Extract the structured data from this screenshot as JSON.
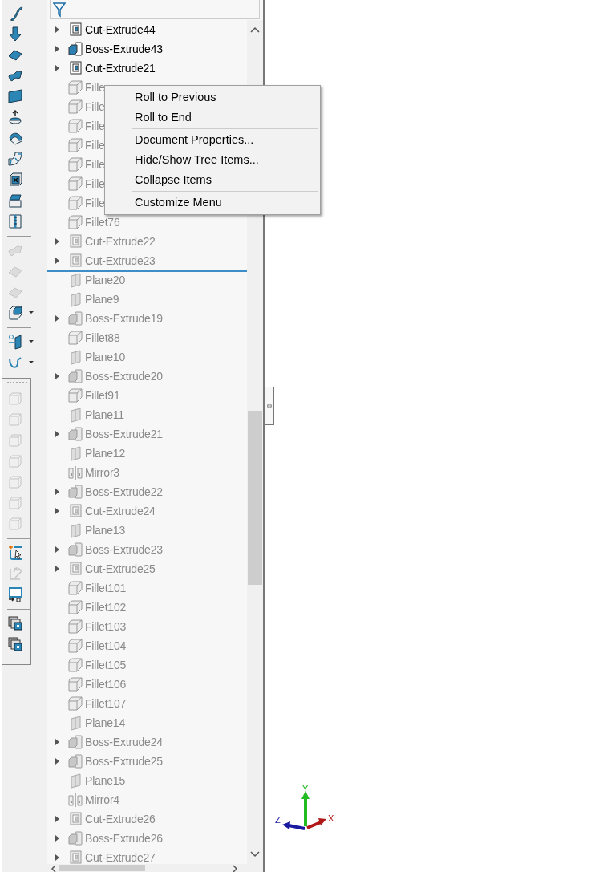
{
  "toolbar": {
    "groups": [
      {
        "buttons": [
          {
            "kind": "swirl",
            "disabled": false,
            "dropdown": false
          },
          {
            "kind": "down-arrow",
            "disabled": false,
            "dropdown": false
          },
          {
            "kind": "sheet",
            "disabled": false,
            "dropdown": false
          },
          {
            "kind": "wave-sheet",
            "disabled": false,
            "dropdown": false
          },
          {
            "kind": "plane",
            "disabled": false,
            "dropdown": false
          },
          {
            "kind": "dome",
            "disabled": false,
            "dropdown": false
          },
          {
            "kind": "curl",
            "disabled": false,
            "dropdown": false
          },
          {
            "kind": "bend",
            "disabled": false,
            "dropdown": false
          },
          {
            "kind": "delete-cube",
            "disabled": false,
            "dropdown": false
          },
          {
            "kind": "box",
            "disabled": false,
            "dropdown": false
          },
          {
            "kind": "zip",
            "disabled": false,
            "dropdown": false
          }
        ]
      },
      {
        "buttons": [
          {
            "kind": "wave-sheet",
            "disabled": true,
            "dropdown": false
          },
          {
            "kind": "sheet",
            "disabled": true,
            "dropdown": false
          },
          {
            "kind": "sheet",
            "disabled": true,
            "dropdown": false
          },
          {
            "kind": "cube",
            "disabled": false,
            "dropdown": true
          }
        ]
      },
      {
        "buttons": [
          {
            "kind": "pin",
            "disabled": false,
            "dropdown": true
          },
          {
            "kind": "curve",
            "disabled": false,
            "dropdown": true
          }
        ]
      }
    ]
  },
  "toolbar_panel": {
    "groups": [
      {
        "buttons": [
          {
            "kind": "wire-cube",
            "disabled": true,
            "dropdown": false
          },
          {
            "kind": "wire-cube",
            "disabled": true,
            "dropdown": false
          },
          {
            "kind": "wire-cube",
            "disabled": true,
            "dropdown": false
          },
          {
            "kind": "wire-cube",
            "disabled": true,
            "dropdown": false
          },
          {
            "kind": "wire-cube",
            "disabled": true,
            "dropdown": false
          },
          {
            "kind": "wire-cube",
            "disabled": true,
            "dropdown": false
          },
          {
            "kind": "wire-cube",
            "disabled": true,
            "dropdown": false
          }
        ]
      },
      {
        "buttons": [
          {
            "kind": "sketch",
            "disabled": false,
            "dropdown": false
          },
          {
            "kind": "wrench",
            "disabled": true,
            "dropdown": false
          },
          {
            "kind": "monitor",
            "disabled": false,
            "dropdown": false
          }
        ]
      },
      {
        "buttons": [
          {
            "kind": "windows",
            "disabled": false,
            "dropdown": false
          },
          {
            "kind": "windows",
            "disabled": false,
            "dropdown": false
          }
        ]
      }
    ]
  },
  "tree": {
    "items": [
      {
        "kind": "cut",
        "label": "Cut-Extrude44",
        "expander": true,
        "rolled_back": false
      },
      {
        "kind": "boss",
        "label": "Boss-Extrude43",
        "expander": true,
        "rolled_back": false
      },
      {
        "kind": "cut",
        "label": "Cut-Extrude21",
        "expander": true,
        "rolled_back": false
      },
      {
        "kind": "fillet",
        "label": "Fille",
        "expander": false,
        "rolled_back": true
      },
      {
        "kind": "fillet",
        "label": "Fille",
        "expander": false,
        "rolled_back": true
      },
      {
        "kind": "fillet",
        "label": "Fille",
        "expander": false,
        "rolled_back": true
      },
      {
        "kind": "fillet",
        "label": "Fille",
        "expander": false,
        "rolled_back": true
      },
      {
        "kind": "fillet",
        "label": "Fille",
        "expander": false,
        "rolled_back": true
      },
      {
        "kind": "fillet",
        "label": "Fille",
        "expander": false,
        "rolled_back": true
      },
      {
        "kind": "fillet",
        "label": "Fille",
        "expander": false,
        "rolled_back": true
      },
      {
        "kind": "fillet",
        "label": "Fillet76",
        "expander": false,
        "rolled_back": true
      },
      {
        "kind": "cut",
        "label": "Cut-Extrude22",
        "expander": true,
        "rolled_back": true
      },
      {
        "kind": "cut",
        "label": "Cut-Extrude23",
        "expander": true,
        "rolled_back": true
      },
      {
        "kind": "rollback"
      },
      {
        "kind": "plane",
        "label": "Plane20",
        "expander": false,
        "rolled_back": true
      },
      {
        "kind": "plane",
        "label": "Plane9",
        "expander": false,
        "rolled_back": true
      },
      {
        "kind": "boss",
        "label": "Boss-Extrude19",
        "expander": true,
        "rolled_back": true
      },
      {
        "kind": "fillet",
        "label": "Fillet88",
        "expander": false,
        "rolled_back": true
      },
      {
        "kind": "plane",
        "label": "Plane10",
        "expander": false,
        "rolled_back": true
      },
      {
        "kind": "boss",
        "label": "Boss-Extrude20",
        "expander": true,
        "rolled_back": true
      },
      {
        "kind": "fillet",
        "label": "Fillet91",
        "expander": false,
        "rolled_back": true
      },
      {
        "kind": "plane",
        "label": "Plane11",
        "expander": false,
        "rolled_back": true
      },
      {
        "kind": "boss",
        "label": "Boss-Extrude21",
        "expander": true,
        "rolled_back": true
      },
      {
        "kind": "plane",
        "label": "Plane12",
        "expander": false,
        "rolled_back": true
      },
      {
        "kind": "mirror",
        "label": "Mirror3",
        "expander": false,
        "rolled_back": true
      },
      {
        "kind": "boss",
        "label": "Boss-Extrude22",
        "expander": true,
        "rolled_back": true
      },
      {
        "kind": "cut",
        "label": "Cut-Extrude24",
        "expander": true,
        "rolled_back": true
      },
      {
        "kind": "plane",
        "label": "Plane13",
        "expander": false,
        "rolled_back": true
      },
      {
        "kind": "boss",
        "label": "Boss-Extrude23",
        "expander": true,
        "rolled_back": true
      },
      {
        "kind": "cut",
        "label": "Cut-Extrude25",
        "expander": true,
        "rolled_back": true
      },
      {
        "kind": "fillet",
        "label": "Fillet101",
        "expander": false,
        "rolled_back": true
      },
      {
        "kind": "fillet",
        "label": "Fillet102",
        "expander": false,
        "rolled_back": true
      },
      {
        "kind": "fillet",
        "label": "Fillet103",
        "expander": false,
        "rolled_back": true
      },
      {
        "kind": "fillet",
        "label": "Fillet104",
        "expander": false,
        "rolled_back": true
      },
      {
        "kind": "fillet",
        "label": "Fillet105",
        "expander": false,
        "rolled_back": true
      },
      {
        "kind": "fillet",
        "label": "Fillet106",
        "expander": false,
        "rolled_back": true
      },
      {
        "kind": "fillet",
        "label": "Fillet107",
        "expander": false,
        "rolled_back": true
      },
      {
        "kind": "plane",
        "label": "Plane14",
        "expander": false,
        "rolled_back": true
      },
      {
        "kind": "boss",
        "label": "Boss-Extrude24",
        "expander": true,
        "rolled_back": true
      },
      {
        "kind": "boss",
        "label": "Boss-Extrude25",
        "expander": true,
        "rolled_back": true
      },
      {
        "kind": "plane",
        "label": "Plane15",
        "expander": false,
        "rolled_back": true
      },
      {
        "kind": "mirror",
        "label": "Mirror4",
        "expander": false,
        "rolled_back": true
      },
      {
        "kind": "cut",
        "label": "Cut-Extrude26",
        "expander": true,
        "rolled_back": true
      },
      {
        "kind": "boss",
        "label": "Boss-Extrude26",
        "expander": true,
        "rolled_back": true
      },
      {
        "kind": "cut",
        "label": "Cut-Extrude27",
        "expander": true,
        "rolled_back": true
      }
    ]
  },
  "context_menu": {
    "items": [
      {
        "kind": "item",
        "label": "Roll to Previous"
      },
      {
        "kind": "item",
        "label": "Roll to End"
      },
      {
        "kind": "separator"
      },
      {
        "kind": "item",
        "label": "Document Properties..."
      },
      {
        "kind": "item",
        "label": "Hide/Show Tree Items..."
      },
      {
        "kind": "item",
        "label": "Collapse Items"
      },
      {
        "kind": "separator"
      },
      {
        "kind": "item",
        "label": "Customize Menu"
      }
    ]
  },
  "triad": {
    "axes": [
      {
        "label": "Y",
        "color": "#22bb22"
      },
      {
        "label": "Z",
        "color": "#1a1aa0"
      },
      {
        "label": "X",
        "color": "#b01818"
      }
    ]
  }
}
